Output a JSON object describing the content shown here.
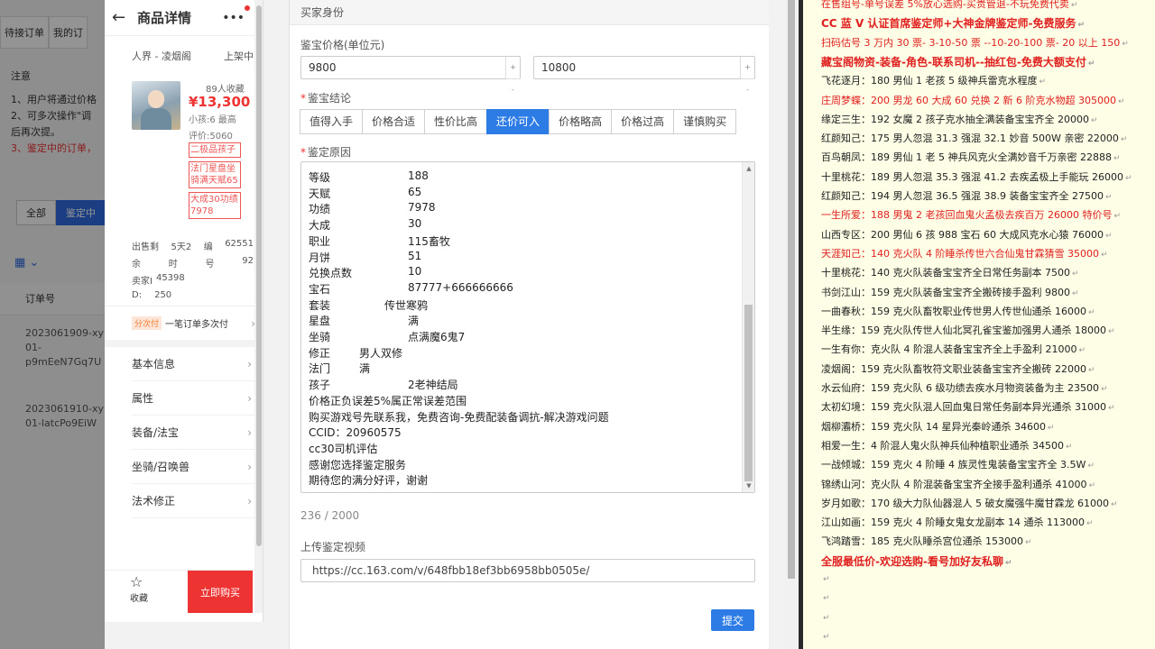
{
  "background": {
    "tabs": [
      "待接订单",
      "我的订"
    ],
    "notes_title": "注意",
    "notes": [
      {
        "text": "1、用户将通过价格",
        "red": false
      },
      {
        "text": "2、可多次操作\"调",
        "red": false
      },
      {
        "text": "后再次提。",
        "red": false
      },
      {
        "text": "3、鉴定中的订单，",
        "red": true
      }
    ],
    "btn_all": "全部",
    "btn_active": "鉴定中",
    "table_header": "订单号",
    "rows": [
      [
        "2023061909-xy",
        "01-",
        "p9mEeN7Gq7U"
      ],
      [
        "2023061910-xy",
        "01-latcPo9EiW"
      ]
    ]
  },
  "phone": {
    "title": "商品详情",
    "server": "人界 - 凌烟阁",
    "status": "上架中",
    "favorites": "89人收藏",
    "price": "¥13,300",
    "meta1": "小孩:6 最高",
    "meta2": "评价:5060",
    "tags": [
      "二极品孩子",
      "法门星盘坐骑满天赋65",
      "大成30功绩7978"
    ],
    "stats": [
      [
        "出售剩",
        "5天2",
        "编",
        "62551"
      ],
      [
        "余",
        "时",
        "号",
        "92"
      ],
      [
        "卖家I",
        "45398",
        "",
        ""
      ],
      [
        "D:",
        "250",
        "",
        ""
      ]
    ],
    "installment_badge": "分次付",
    "installment_text": "一笔订单多次付",
    "menu": [
      "基本信息",
      "属性",
      "装备/法宝",
      "坐骑/召唤兽",
      "法术修正"
    ],
    "fav_label": "收藏",
    "buy_label": "立即购买"
  },
  "form": {
    "section_title": "买家身份",
    "price_label": "鉴宝价格(单位元)",
    "price_min": "9800",
    "price_max": "10800",
    "conclusion_label": "鉴宝结论",
    "conclusions": [
      "值得入手",
      "价格合适",
      "性价比高",
      "还价可入",
      "价格略高",
      "价格过高",
      "谨慎购买"
    ],
    "active_conclusion": "还价可入",
    "reason_label": "鉴定原因",
    "reason_lines": [
      {
        "k": "等级",
        "v": "188",
        "vx": 110
      },
      {
        "k": "天赋",
        "v": "65",
        "vx": 110
      },
      {
        "k": "功绩",
        "v": "7978",
        "vx": 110
      },
      {
        "k": "大成",
        "v": "30",
        "vx": 110
      },
      {
        "k": "职业",
        "v": "115畜牧",
        "vx": 110
      },
      {
        "k": "月饼",
        "v": "51",
        "vx": 110
      },
      {
        "k": "兑换点数",
        "v": "10",
        "vx": 110
      },
      {
        "k": "宝石",
        "v": "87777+666666666",
        "vx": 110
      },
      {
        "k": "套装",
        "v": "传世寒鸦",
        "vx": 84
      },
      {
        "k": "星盘",
        "v": "满",
        "vx": 110
      },
      {
        "k": "坐骑",
        "v": "点满魔6鬼7",
        "vx": 110
      },
      {
        "k": "修正",
        "v": "男人双修",
        "vx": 56
      },
      {
        "k": "法门",
        "v": "满",
        "vx": 56
      },
      {
        "k": "孩子",
        "v": "2老神结局",
        "vx": 110
      },
      {
        "k": "价格正负误差5%属正常误差范围",
        "v": "",
        "vx": 0
      },
      {
        "k": "购买游戏号先联系我，免费咨询-免费配装备调抗-解决游戏问题",
        "v": "",
        "vx": 0
      },
      {
        "k": "CCID：20960575",
        "v": "",
        "vx": 0
      },
      {
        "k": "cc30司机评估",
        "v": "",
        "vx": 0
      },
      {
        "k": "感谢您选择鉴定服务",
        "v": "",
        "vx": 0
      },
      {
        "k": "期待您的满分好评，谢谢",
        "v": "",
        "vx": 0
      }
    ],
    "counter": "236 / 2000",
    "video_label": "上传鉴定视频",
    "video_url": "https://cc.163.com/v/648fbb18ef3bb6958bb0505e/",
    "submit_label": "提交"
  },
  "right_panel": {
    "lines": [
      {
        "text": "在售组号-单号误差 5%放心选购-买贵管退-不玩免费代卖",
        "red": true,
        "bold": false
      },
      {
        "text": "CC 蓝 V 认证首席鉴定师+大神金牌鉴定师-免费服务",
        "red": true,
        "bold": true
      },
      {
        "text": "扫码估号 3 万内 30 票- 3-10-50 票  --10-20-100 票- 20 以上 150",
        "red": true,
        "bold": false
      },
      {
        "text": "藏宝阁物资-装备-角色-联系司机--抽红包-免费大额支付",
        "red": true,
        "bold": true
      },
      {
        "text": "飞花逐月：180 男仙 1 老孩 5 级神兵雷克水程度",
        "red": false,
        "bold": false
      },
      {
        "text": "庄周梦蝶：200 男龙 60 大成 60 兑换 2 新 6 阶克水物超 305000",
        "red": true,
        "bold": false
      },
      {
        "text": "缘定三生：192 女魔 2 孩子克水抽全满装备宝宝齐全 20000",
        "red": false,
        "bold": false
      },
      {
        "text": "红颜知己：175 男人忽混 31.3 强混 32.1 妙音 500W 亲密 22000",
        "red": false,
        "bold": false
      },
      {
        "text": "百鸟朝凤：189 男仙 1 老 5 神兵风克火全满妙音千万亲密 22888",
        "red": false,
        "bold": false
      },
      {
        "text": "十里桃花：189 男人忽混 35.3 强混 41.2 去疾孟极上手能玩 26000",
        "red": false,
        "bold": false
      },
      {
        "text": "红颜知己：194 男人忽混 36.5 强混 38.9 装备宝宝齐全 27500",
        "red": false,
        "bold": false
      },
      {
        "text": "一生所爱：188 男鬼 2 老孩回血鬼火孟极去疾百万 26000 特价号",
        "red": true,
        "bold": false
      },
      {
        "text": "山西专区：200 男仙 6 孩 988 宝石 60 大成风克水心猿 76000",
        "red": false,
        "bold": false
      },
      {
        "text": "天涯知己：140 克火队 4 阶睡杀传世六合仙鬼甘霖猜雪 35000",
        "red": true,
        "bold": false
      },
      {
        "text": "十里桃花：140 克火队装备宝宝齐全日常任务副本 7500",
        "red": false,
        "bold": false
      },
      {
        "text": "书剑江山：159 克火队装备宝宝齐全搬砖接手盈利 9800",
        "red": false,
        "bold": false
      },
      {
        "text": "一曲春秋：159 克火队畜牧职业传世男人传世仙通杀 16000",
        "red": false,
        "bold": false
      },
      {
        "text": "半生缘：159 克火队传世人仙北冥孔雀宝鉴加强男人通杀 18000",
        "red": false,
        "bold": false
      },
      {
        "text": "一生有你：克火队 4 阶混人装备宝宝齐全上手盈利 21000",
        "red": false,
        "bold": false
      },
      {
        "text": "凌烟阁：159 克火队畜牧符文职业装备宝宝齐全搬砖 22000",
        "red": false,
        "bold": false
      },
      {
        "text": "水云仙府：159 克火队 6 级功绩去疾水月物资装备为主 23500",
        "red": false,
        "bold": false
      },
      {
        "text": "太初幻境：159 克火队混人回血鬼日常任务副本异光通杀 31000",
        "red": false,
        "bold": false
      },
      {
        "text": "烟柳灞桥：159 克火队 14 星异光秦岭通杀 34600",
        "red": false,
        "bold": false
      },
      {
        "text": "相爱一生：4 阶混人鬼火队神兵仙种植职业通杀 34500",
        "red": false,
        "bold": false
      },
      {
        "text": "一战倾城：159 克火 4 阶睡 4 族灵性鬼装备宝宝齐全 3.5W",
        "red": false,
        "bold": false
      },
      {
        "text": "锦绣山河：克火队 4 阶混装备宝宝齐全接手盈利通杀 41000",
        "red": false,
        "bold": false
      },
      {
        "text": "岁月如歌：170 级大力队仙器混人 5 破女魔强牛魔甘霖龙 61000",
        "red": false,
        "bold": false
      },
      {
        "text": "江山如画：159 克火 4 阶睡女鬼女龙副本 14 通杀 113000",
        "red": false,
        "bold": false
      },
      {
        "text": "飞鸿踏雪：185 克火队睡杀宫位通杀 153000",
        "red": false,
        "bold": false
      },
      {
        "text": "全服最低价-欢迎选购-看号加好友私聊",
        "red": true,
        "bold": true
      },
      {
        "text": "",
        "red": false,
        "bold": false
      },
      {
        "text": "",
        "red": false,
        "bold": false
      },
      {
        "text": "",
        "red": false,
        "bold": false
      },
      {
        "text": "",
        "red": false,
        "bold": false
      },
      {
        "text": "",
        "red": false,
        "bold": false
      }
    ]
  },
  "colors": {
    "accent": "#2d7be5",
    "danger": "#e33333",
    "note_bg": "#fefde5"
  }
}
